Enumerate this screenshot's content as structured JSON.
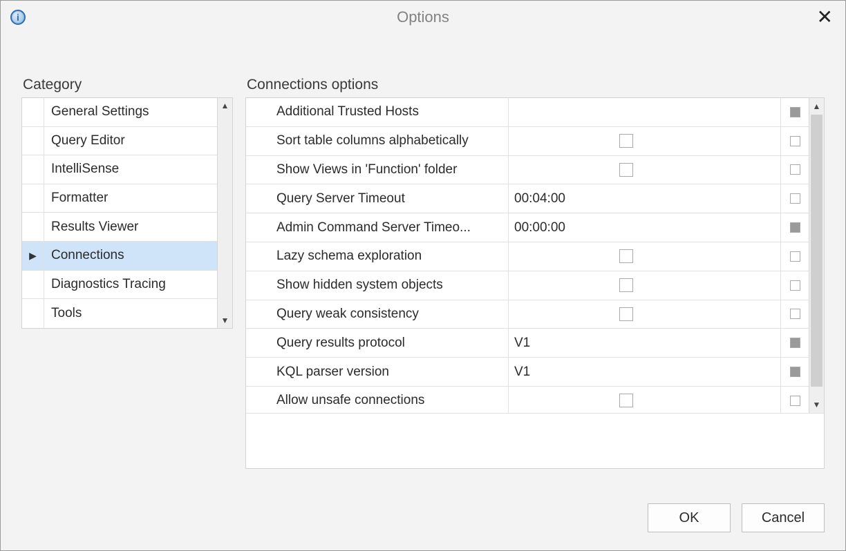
{
  "window": {
    "title": "Options",
    "close_glyph": "✕",
    "info_glyph": "i"
  },
  "category": {
    "label": "Category",
    "items": [
      {
        "name": "General Settings",
        "selected": false
      },
      {
        "name": "Query Editor",
        "selected": false
      },
      {
        "name": "IntelliSense",
        "selected": false
      },
      {
        "name": "Formatter",
        "selected": false
      },
      {
        "name": "Results Viewer",
        "selected": false
      },
      {
        "name": "Connections",
        "selected": true
      },
      {
        "name": "Diagnostics Tracing",
        "selected": false
      },
      {
        "name": "Tools",
        "selected": false
      }
    ],
    "arrow_up": "▲",
    "arrow_down": "▼"
  },
  "options": {
    "label": "Connections options",
    "rows": [
      {
        "label": "Additional Trusted Hosts",
        "type": "text",
        "value": "",
        "meta_filled": true
      },
      {
        "label": "Sort table columns alphabetically",
        "type": "check",
        "checked": false,
        "meta_filled": false
      },
      {
        "label": "Show Views in 'Function' folder",
        "type": "check",
        "checked": false,
        "meta_filled": false
      },
      {
        "label": "Query Server Timeout",
        "type": "text",
        "value": "00:04:00",
        "meta_filled": false
      },
      {
        "label": "Admin Command Server Timeo...",
        "type": "text",
        "value": "00:00:00",
        "meta_filled": true
      },
      {
        "label": "Lazy schema exploration",
        "type": "check",
        "checked": false,
        "meta_filled": false
      },
      {
        "label": "Show hidden system objects",
        "type": "check",
        "checked": false,
        "meta_filled": false
      },
      {
        "label": "Query weak consistency",
        "type": "check",
        "checked": false,
        "meta_filled": false
      },
      {
        "label": "Query results protocol",
        "type": "text",
        "value": "V1",
        "meta_filled": true
      },
      {
        "label": "KQL parser version",
        "type": "text",
        "value": "V1",
        "meta_filled": true
      },
      {
        "label": "Allow unsafe connections",
        "type": "check",
        "checked": false,
        "meta_filled": false
      }
    ],
    "arrow_up": "▲",
    "arrow_down": "▼"
  },
  "buttons": {
    "ok": "OK",
    "cancel": "Cancel"
  }
}
